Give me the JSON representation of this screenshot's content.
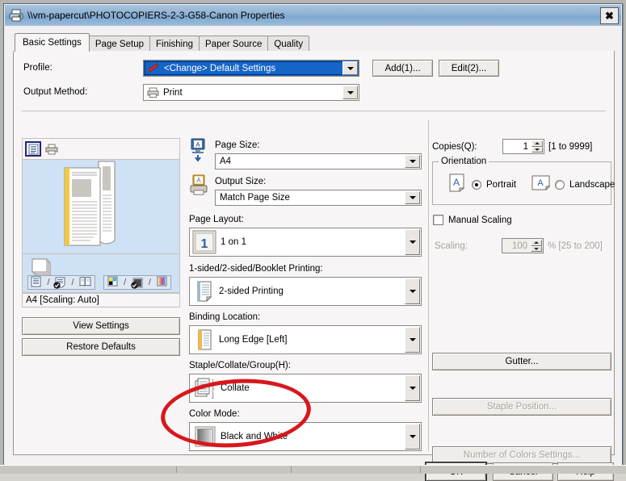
{
  "window": {
    "title": "\\\\vm-papercut\\PHOTOCOPIERS-2-3-G58-Canon Properties",
    "title_icon": "printer-icon",
    "close_label": "✖"
  },
  "tabs": [
    {
      "label": "Basic Settings",
      "active": true
    },
    {
      "label": "Page Setup",
      "active": false
    },
    {
      "label": "Finishing",
      "active": false
    },
    {
      "label": "Paper Source",
      "active": false
    },
    {
      "label": "Quality",
      "active": false
    }
  ],
  "top": {
    "profile_label": "Profile:",
    "profile_value": "<Change> Default Settings",
    "profile_icon": "pencil-icon",
    "add_button": "Add(1)...",
    "edit_button": "Edit(2)...",
    "output_method_label": "Output Method:",
    "output_method_value": "Print",
    "output_method_icon": "printer-small-icon"
  },
  "preview": {
    "toolbar": [
      {
        "name": "page-preview-icon",
        "selected": true
      },
      {
        "name": "printer-preview-icon",
        "selected": false
      }
    ],
    "status": "A4 [Scaling: Auto]",
    "view_settings_button": "View Settings",
    "restore_defaults_button": "Restore Defaults",
    "sided_icons": [
      "one-sided-icon",
      "two-sided-icon-checked",
      "booklet-icon"
    ],
    "color_icons": [
      "color-icon",
      "black-white-icon-checked",
      "gradient-icon"
    ]
  },
  "middle": {
    "page_size_label": "Page Size:",
    "page_size_value": "A4",
    "page_size_icon": "page-size-icon",
    "output_size_label": "Output Size:",
    "output_size_value": "Match Page Size",
    "output_size_icon": "output-size-icon",
    "page_layout_label": "Page Layout:",
    "page_layout_value": "1 on 1",
    "page_layout_icon": "one-up-icon",
    "sided_label": "1-sided/2-sided/Booklet Printing:",
    "sided_value": "2-sided Printing",
    "sided_icon": "two-sided-print-icon",
    "binding_label": "Binding Location:",
    "binding_value": "Long Edge [Left]",
    "binding_icon": "long-edge-binding-icon",
    "staple_label": "Staple/Collate/Group(H):",
    "staple_value": "Collate",
    "staple_icon": "collate-icon",
    "color_mode_label": "Color Mode:",
    "color_mode_value": "Black and White",
    "color_mode_icon": "grayscale-swatch-icon"
  },
  "right": {
    "copies_label": "Copies(Q):",
    "copies_value": "1",
    "copies_range": "[1 to 9999]",
    "orientation_title": "Orientation",
    "orientation_portrait": "Portrait",
    "orientation_landscape": "Landscape",
    "orientation_selected": "Portrait",
    "portrait_icon": "portrait-page-icon",
    "landscape_icon": "landscape-page-icon",
    "manual_scaling_label": "Manual Scaling",
    "manual_scaling_checked": false,
    "scaling_label": "Scaling:",
    "scaling_value": "100",
    "scaling_unit_range": "% [25 to 200]",
    "gutter_button": "Gutter...",
    "staple_position_button": "Staple Position...",
    "number_of_colors_button": "Number of Colors Settings..."
  },
  "footer": {
    "ok_button": "OK",
    "cancel_button": "Cancel",
    "help_button": "Help"
  },
  "annotation": {
    "shape": "red-ellipse-highlight",
    "color": "#d7171c"
  }
}
